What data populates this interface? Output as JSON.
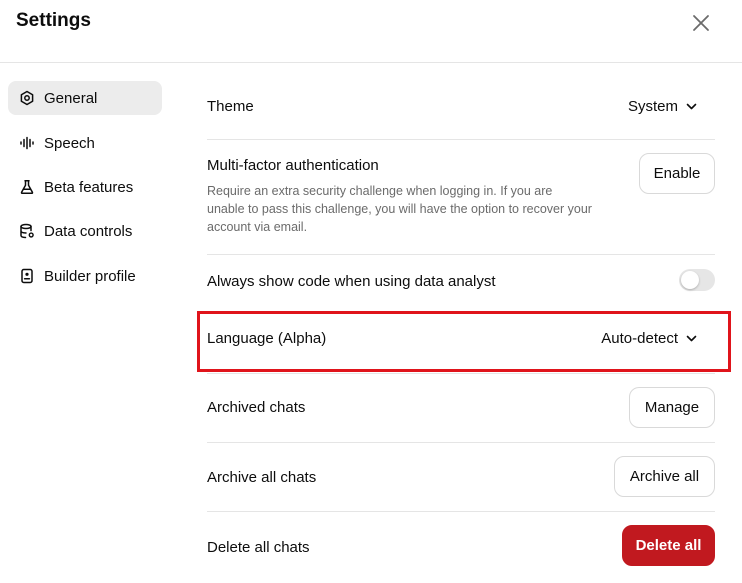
{
  "header": {
    "title": "Settings"
  },
  "sidebar": {
    "items": [
      {
        "label": "General",
        "icon": "gear-icon",
        "active": true
      },
      {
        "label": "Speech",
        "icon": "waveform-icon",
        "active": false
      },
      {
        "label": "Beta features",
        "icon": "flask-icon",
        "active": false
      },
      {
        "label": "Data controls",
        "icon": "database-gear-icon",
        "active": false
      },
      {
        "label": "Builder profile",
        "icon": "id-badge-icon",
        "active": false
      }
    ]
  },
  "settings": {
    "theme": {
      "label": "Theme",
      "value": "System"
    },
    "mfa": {
      "label": "Multi-factor authentication",
      "description": "Require an extra security challenge when logging in. If you are unable to pass this challenge, you will have the option to recover your account via email.",
      "button": "Enable"
    },
    "code_toggle": {
      "label": "Always show code when using data analyst",
      "on": false
    },
    "language": {
      "label": "Language (Alpha)",
      "value": "Auto-detect"
    },
    "archived": {
      "label": "Archived chats",
      "button": "Manage"
    },
    "archive_all": {
      "label": "Archive all chats",
      "button": "Archive all"
    },
    "delete_all": {
      "label": "Delete all chats",
      "button": "Delete all"
    }
  },
  "colors": {
    "accent_danger": "#c1191f",
    "highlight": "#e0141b",
    "active_nav_bg": "#ececec"
  }
}
